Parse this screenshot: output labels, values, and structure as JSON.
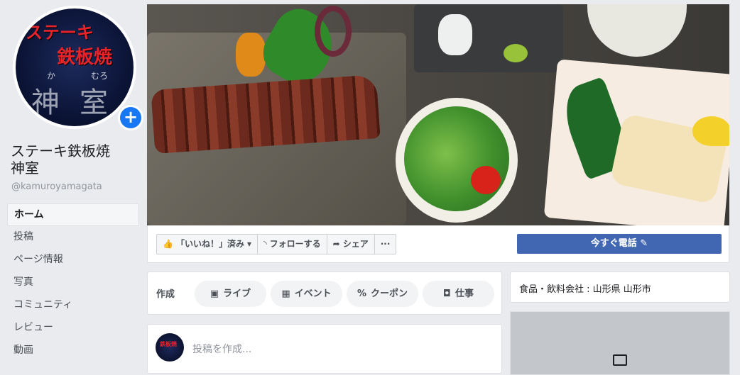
{
  "sidebar": {
    "avatar": {
      "line1": "ステーキ",
      "line2": "鉄板焼",
      "ruby1": "か",
      "ruby2": "むろ",
      "kanji": "神室"
    },
    "add_icon": "+",
    "page_name": "ステーキ鉄板焼\n神室",
    "handle": "@kamuroyamagata",
    "nav": [
      {
        "label": "ホーム",
        "active": true
      },
      {
        "label": "投稿"
      },
      {
        "label": "ページ情報"
      },
      {
        "label": "写真"
      },
      {
        "label": "コミュニティ"
      },
      {
        "label": "レビュー"
      },
      {
        "label": "動画"
      }
    ]
  },
  "actions": {
    "liked": "「いいね！」済み",
    "liked_caret": "▾",
    "follow": "フォローする",
    "share": "シェア",
    "more": "···",
    "call": "今すぐ電話 ✎"
  },
  "create": {
    "label": "作成",
    "pills": [
      {
        "icon": "▣",
        "label": "ライブ"
      },
      {
        "icon": "▦",
        "label": "イベント"
      },
      {
        "icon": "%",
        "label": "クーポン"
      },
      {
        "icon": "◘",
        "label": "仕事"
      }
    ]
  },
  "composer": {
    "placeholder": "投稿を作成..."
  },
  "info": {
    "category": "食品・飲料会社 : 山形県 山形市"
  },
  "colors": {
    "accent": "#4267b2",
    "fb_blue": "#1877f2",
    "background": "#e9ebee"
  }
}
